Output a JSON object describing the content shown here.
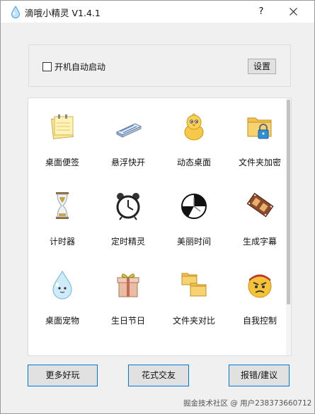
{
  "window": {
    "title": "滴哦小精灵 V1.4.1",
    "help_label": "?"
  },
  "startup": {
    "checkbox_label": "开机自动启动",
    "checked": false,
    "settings_label": "设置"
  },
  "tools": [
    {
      "label": "桌面便签",
      "icon": "sticky-note-icon"
    },
    {
      "label": "悬浮快开",
      "icon": "floating-launcher-icon"
    },
    {
      "label": "动态桌面",
      "icon": "chick-icon"
    },
    {
      "label": "文件夹加密",
      "icon": "locked-folder-icon"
    },
    {
      "label": "计时器",
      "icon": "hourglass-icon"
    },
    {
      "label": "定时精灵",
      "icon": "alarm-clock-icon"
    },
    {
      "label": "美丽时间",
      "icon": "clock-face-icon"
    },
    {
      "label": "生成字幕",
      "icon": "film-strip-icon"
    },
    {
      "label": "桌面宠物",
      "icon": "water-drop-pet-icon"
    },
    {
      "label": "生日节日",
      "icon": "gift-box-icon"
    },
    {
      "label": "文件夹对比",
      "icon": "folder-compare-icon"
    },
    {
      "label": "自我控制",
      "icon": "angry-face-icon"
    }
  ],
  "buttons": {
    "more": "更多好玩",
    "fancy": "花式交友",
    "report": "报错/建议"
  },
  "watermark": "掘金技术社区 @ 用户2383736607​12",
  "colors": {
    "accent_border": "#0078d7",
    "panel_bg": "#ffffff",
    "window_bg": "#f0f0f0"
  }
}
